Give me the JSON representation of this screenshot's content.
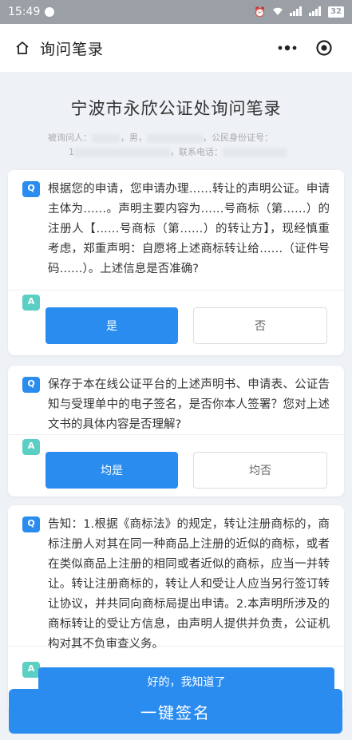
{
  "status_bar": {
    "time": "15:49",
    "battery": "32"
  },
  "header": {
    "title": "询问笔录"
  },
  "document": {
    "title": "宁波市永欣公证处询问笔录",
    "meta_line1": {
      "label_interviewee": "被询问人：",
      "gender": "，男，",
      "label_id": "，公民身份证号："
    },
    "meta_line2": {
      "prefix": "1",
      "label_phone": "，联系电话："
    }
  },
  "questions": [
    {
      "q_text": "根据您的申请，您申请办理……转让的声明公证。申请主体为……。声明主要内容为……号商标（第……）的注册人【……号商标（第……）的转让方】，现经慎重考虑，郑重声明：自愿将上述商标转让给……（证件号码……）。上述信息是否准确?",
      "options": [
        "是",
        "否"
      ]
    },
    {
      "q_text": "保存于本在线公证平台的上述声明书、申请表、公证告知与受理单中的电子签名，是否你本人签署？您对上述文书的具体内容是否理解?",
      "options": [
        "均是",
        "均否"
      ]
    },
    {
      "q_text": "告知：1.根据《商标法》的规定，转让注册商标的，商标注册人对其在同一种商品上注册的近似的商标，或者在类似商品上注册的相同或者近似的商标，应当一并转让。转让注册商标的，转让人和受让人应当另行签订转让协议，并共同向商标局提出申请。2.本声明所涉及的商标转让的受让方信息，由声明人提供并负责，公证机构对其不负审查义务。",
      "options": [
        "好的，我知道了"
      ]
    }
  ],
  "sign_button": {
    "label": "一键签名"
  },
  "badges": {
    "q": "Q",
    "a": "A"
  },
  "colors": {
    "accent": "#2b8cf0",
    "answer_badge": "#5ccfc4",
    "background": "#eef1f5"
  },
  "icons": {
    "home": "home-icon",
    "more": "more-dots-icon",
    "close": "target-close-icon"
  }
}
